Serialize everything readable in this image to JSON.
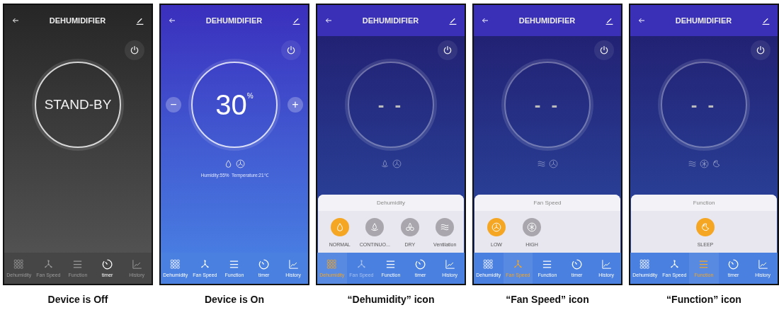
{
  "screens": [
    {
      "powered": false,
      "title": "DEHUMIDIFIER",
      "display": {
        "kind": "text",
        "value": "STAND-BY"
      },
      "nav": [
        {
          "label": "Dehumidity",
          "selected": false,
          "disabled": true
        },
        {
          "label": "Fan Speed",
          "selected": false,
          "disabled": true
        },
        {
          "label": "Function",
          "selected": false,
          "disabled": true
        },
        {
          "label": "timer",
          "selected": false,
          "disabled": false
        },
        {
          "label": "History",
          "selected": false,
          "disabled": true
        }
      ],
      "caption": "Device is Off"
    },
    {
      "powered": true,
      "title": "DEHUMIDIFIER",
      "display": {
        "kind": "number",
        "value": "30",
        "unit": "%"
      },
      "adjust": {
        "minus": "−",
        "plus": "+"
      },
      "status_icons": [
        {
          "kind": "drop"
        },
        {
          "kind": "fan"
        }
      ],
      "reading": "Humidity:55%  Temperature:21℃",
      "nav": [
        {
          "label": "Dehumidity",
          "selected": false,
          "disabled": false
        },
        {
          "label": "Fan Speed",
          "selected": false,
          "disabled": false
        },
        {
          "label": "Function",
          "selected": false,
          "disabled": false
        },
        {
          "label": "timer",
          "selected": false,
          "disabled": false
        },
        {
          "label": "History",
          "selected": false,
          "disabled": false
        }
      ],
      "caption": "Device is On"
    },
    {
      "powered": true,
      "title": "DEHUMIDIFIER",
      "display": {
        "kind": "dashes",
        "value": "- -"
      },
      "status_icons": [
        {
          "kind": "drop-base"
        },
        {
          "kind": "fan"
        }
      ],
      "panel": {
        "title": "Dehumidity",
        "options": [
          {
            "kind": "drop",
            "label": "NORMAL",
            "selected": true
          },
          {
            "kind": "drop-base",
            "label": "CONTINUO...",
            "selected": false
          },
          {
            "kind": "dry",
            "label": "DRY",
            "selected": false
          },
          {
            "kind": "waves",
            "label": "Ventilation",
            "selected": false
          }
        ]
      },
      "nav": [
        {
          "label": "Dehumidity",
          "selected": true,
          "disabled": false
        },
        {
          "label": "Fan Speed",
          "selected": false,
          "disabled": true
        },
        {
          "label": "Function",
          "selected": false,
          "disabled": false
        },
        {
          "label": "timer",
          "selected": false,
          "disabled": false
        },
        {
          "label": "History",
          "selected": false,
          "disabled": false
        }
      ],
      "caption": "“Dehumidity” icon"
    },
    {
      "powered": true,
      "title": "DEHUMIDIFIER",
      "display": {
        "kind": "dashes",
        "value": "- -"
      },
      "status_icons": [
        {
          "kind": "waves"
        },
        {
          "kind": "fan"
        }
      ],
      "panel": {
        "title": "Fan Speed",
        "options": [
          {
            "kind": "fan",
            "label": "LOW",
            "selected": true
          },
          {
            "kind": "fan-high",
            "label": "HIGH",
            "selected": false
          }
        ]
      },
      "nav": [
        {
          "label": "Dehumidity",
          "selected": false,
          "disabled": false
        },
        {
          "label": "Fan Speed",
          "selected": true,
          "disabled": false
        },
        {
          "label": "Function",
          "selected": false,
          "disabled": false
        },
        {
          "label": "timer",
          "selected": false,
          "disabled": false
        },
        {
          "label": "History",
          "selected": false,
          "disabled": false
        }
      ],
      "caption": "“Fan Speed” icon"
    },
    {
      "powered": true,
      "title": "DEHUMIDIFIER",
      "display": {
        "kind": "dashes",
        "value": "- -"
      },
      "status_icons": [
        {
          "kind": "waves"
        },
        {
          "kind": "fan-high"
        },
        {
          "kind": "moon"
        }
      ],
      "panel": {
        "title": "Function",
        "options": [
          {
            "kind": "moon",
            "label": "SLEEP",
            "selected": true
          }
        ]
      },
      "nav": [
        {
          "label": "Dehumidity",
          "selected": false,
          "disabled": false
        },
        {
          "label": "Fan Speed",
          "selected": false,
          "disabled": false
        },
        {
          "label": "Function",
          "selected": true,
          "disabled": false
        },
        {
          "label": "timer",
          "selected": false,
          "disabled": false
        },
        {
          "label": "History",
          "selected": false,
          "disabled": false
        }
      ],
      "caption": "“Function” icon"
    }
  ]
}
